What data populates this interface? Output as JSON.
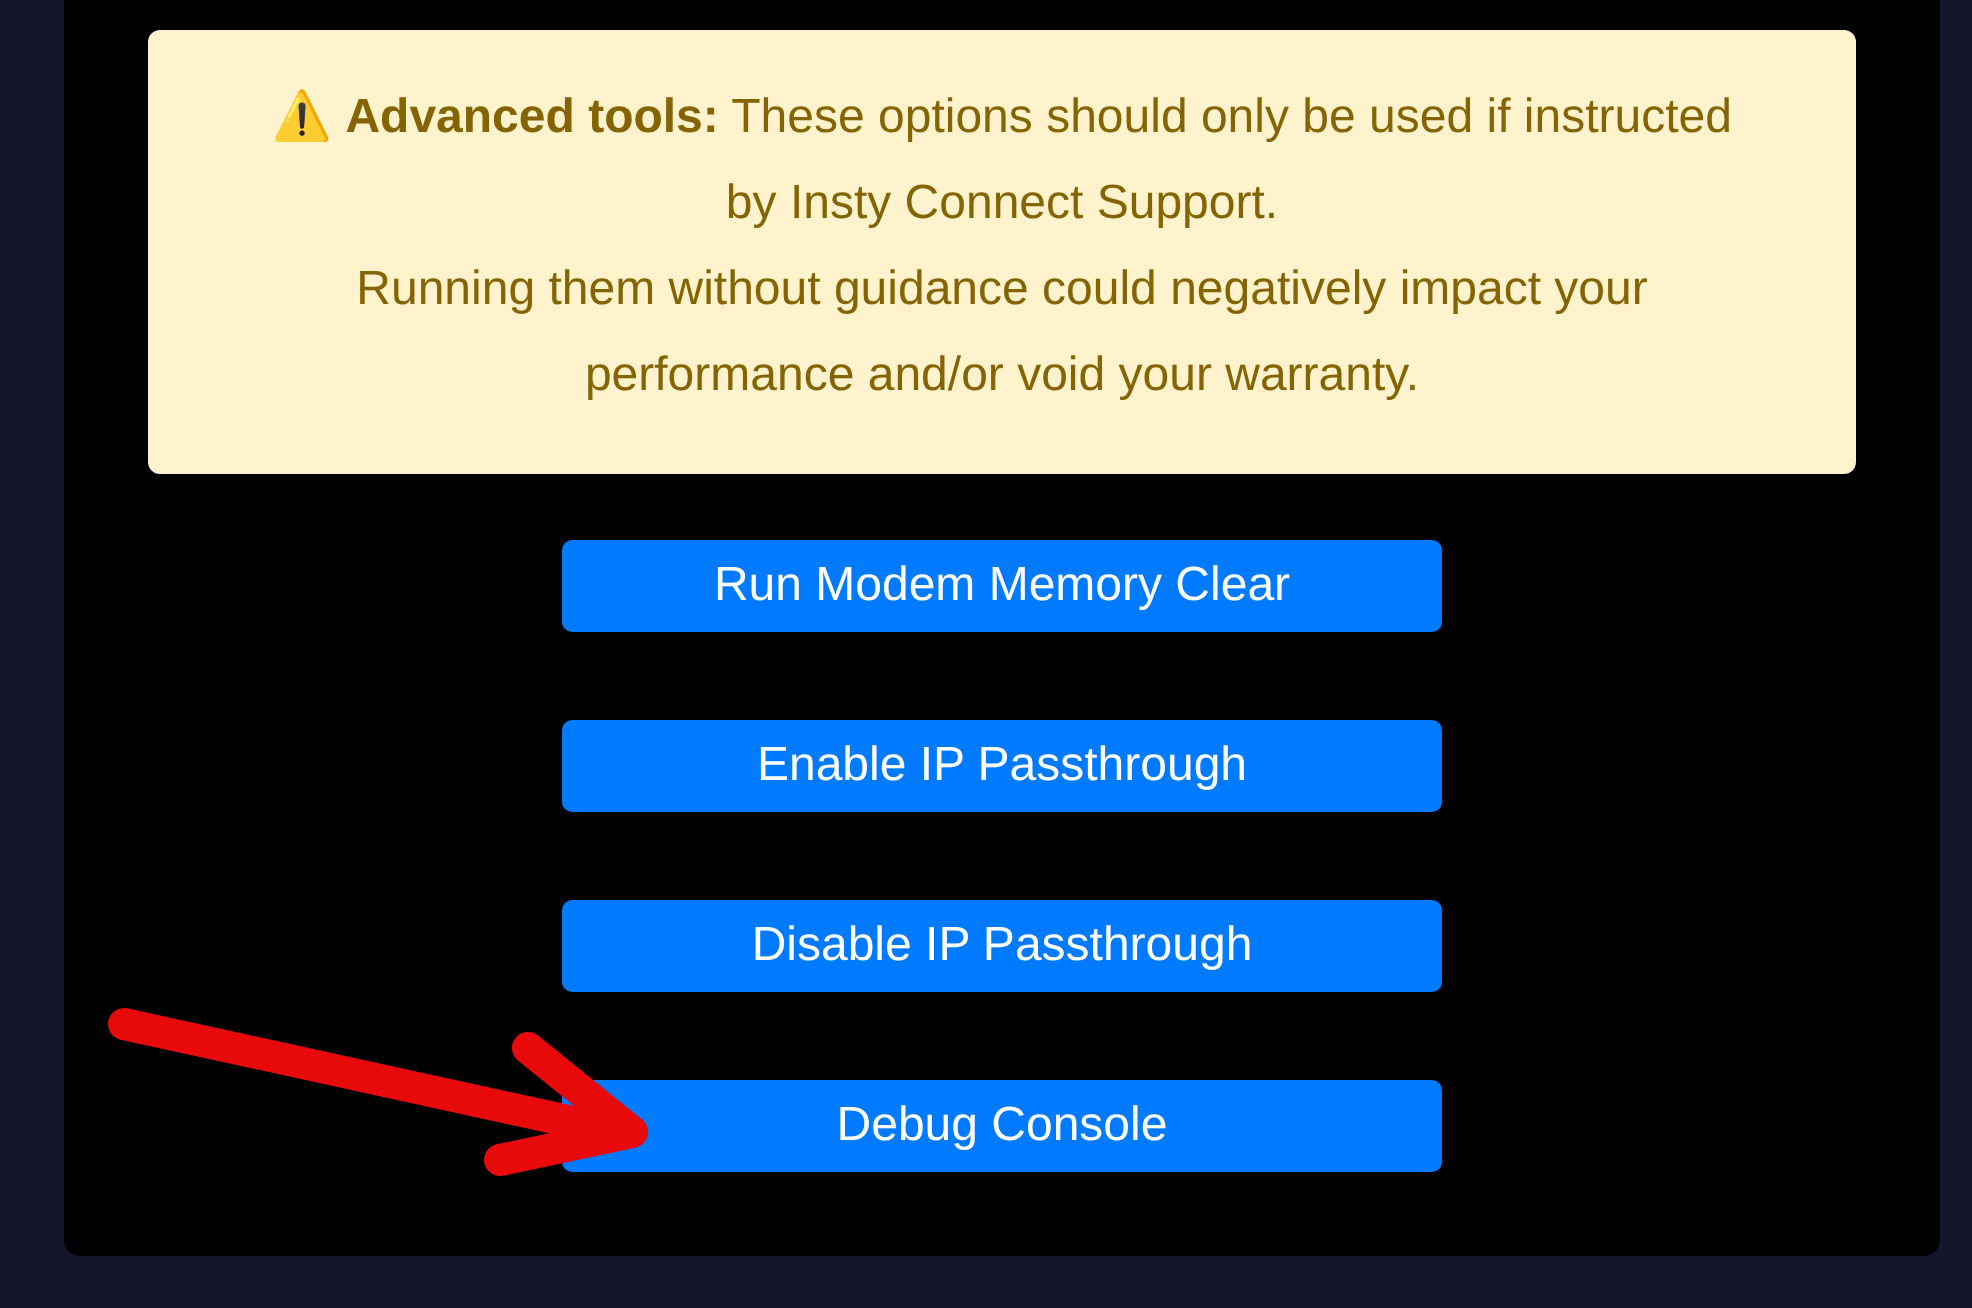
{
  "warning": {
    "icon": "⚠️",
    "title": "Advanced tools:",
    "paragraphs": [
      "These options should only be used if instructed by Insty Connect Support.",
      "Running them without guidance could negatively impact your performance and/or void your warranty."
    ]
  },
  "buttons": [
    {
      "label": "Run Modem Memory Clear"
    },
    {
      "label": "Enable IP Passthrough"
    },
    {
      "label": "Disable IP Passthrough"
    },
    {
      "label": "Debug Console"
    }
  ]
}
